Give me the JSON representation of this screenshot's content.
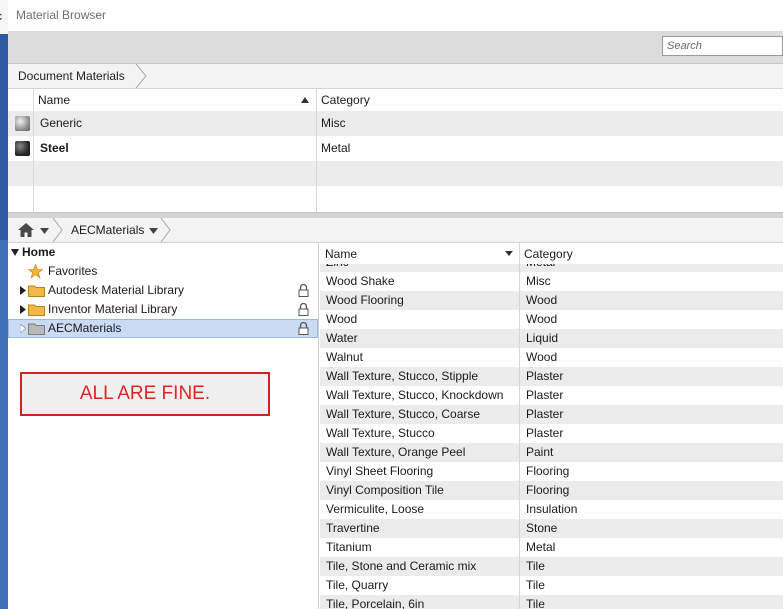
{
  "window": {
    "title": "Material Browser"
  },
  "search": {
    "placeholder": "Search"
  },
  "document_breadcrumb": {
    "label": "Document Materials"
  },
  "document_table": {
    "columns": [
      "Name",
      "Category"
    ],
    "rows": [
      {
        "name": "Generic",
        "category": "Misc",
        "icon": "gray-sphere-icon",
        "bold": false
      },
      {
        "name": "Steel",
        "category": "Metal",
        "icon": "dark-sphere-icon",
        "bold": true
      }
    ]
  },
  "library_breadcrumb": {
    "current": "AECMaterials"
  },
  "tree": {
    "home": "Home",
    "items": [
      {
        "label": "Favorites",
        "icon": "star-icon"
      },
      {
        "label": "Autodesk Material Library",
        "icon": "folder-icon",
        "locked": true
      },
      {
        "label": "Inventor Material Library",
        "icon": "folder-icon",
        "locked": true
      },
      {
        "label": "AECMaterials",
        "icon": "folder-icon",
        "locked": true,
        "selected": true
      }
    ]
  },
  "annotation": {
    "text": "ALL ARE FINE."
  },
  "library_table": {
    "columns": [
      "Name",
      "Category"
    ],
    "partial_top": {
      "name": "Zinc",
      "category": "Metal"
    },
    "rows": [
      {
        "name": "Wood Shake",
        "category": "Misc"
      },
      {
        "name": "Wood Flooring",
        "category": "Wood"
      },
      {
        "name": "Wood",
        "category": "Wood"
      },
      {
        "name": "Water",
        "category": "Liquid"
      },
      {
        "name": "Walnut",
        "category": "Wood"
      },
      {
        "name": "Wall Texture, Stucco, Stipple",
        "category": "Plaster"
      },
      {
        "name": "Wall Texture, Stucco, Knockdown",
        "category": "Plaster"
      },
      {
        "name": "Wall Texture, Stucco, Coarse",
        "category": "Plaster"
      },
      {
        "name": "Wall Texture, Stucco",
        "category": "Plaster"
      },
      {
        "name": "Wall Texture, Orange Peel",
        "category": "Paint"
      },
      {
        "name": "Vinyl Sheet Flooring",
        "category": "Flooring"
      },
      {
        "name": "Vinyl Composition Tile",
        "category": "Flooring"
      },
      {
        "name": "Vermiculite, Loose",
        "category": "Insulation"
      },
      {
        "name": "Travertine",
        "category": "Stone"
      },
      {
        "name": "Titanium",
        "category": "Metal"
      },
      {
        "name": "Tile, Stone and Ceramic mix",
        "category": "Tile"
      },
      {
        "name": "Tile, Quarry",
        "category": "Tile"
      },
      {
        "name": "Tile, Porcelain, 6in",
        "category": "Tile"
      }
    ]
  },
  "colors": {
    "selection": "#c9dcf3",
    "annotation": "#e02424",
    "folder": "#f0b84a"
  }
}
